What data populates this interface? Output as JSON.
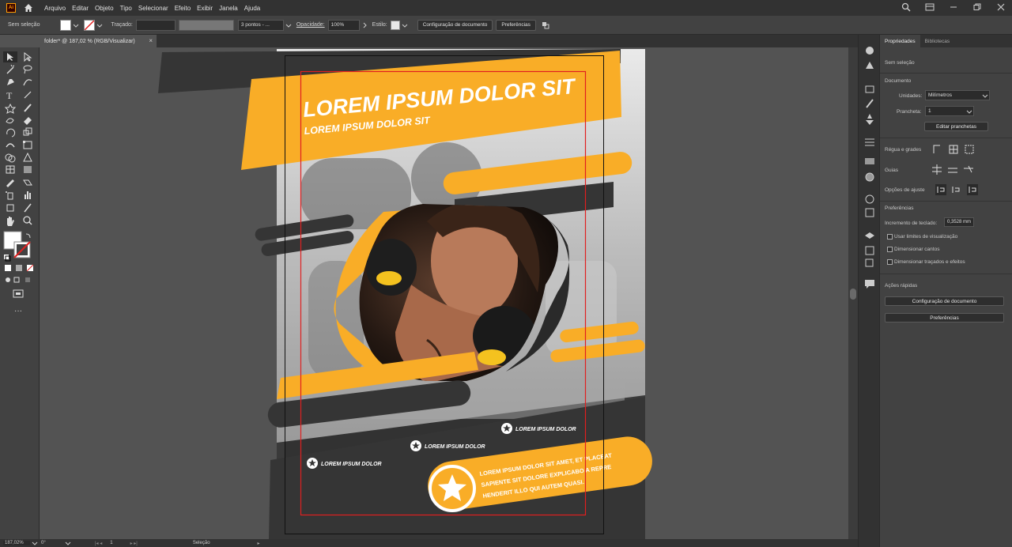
{
  "app": {
    "logo": "Ai"
  },
  "menu": [
    "Arquivo",
    "Editar",
    "Objeto",
    "Tipo",
    "Selecionar",
    "Efeito",
    "Exibir",
    "Janela",
    "Ajuda"
  ],
  "control": {
    "selection": "Sem seleção",
    "stroke_label": "Traçado:",
    "brush": "3 pontos - ...",
    "opacity_label": "Opacidade:",
    "opacity": "100%",
    "style_label": "Estilo:",
    "doc_setup": "Configuração de documento",
    "prefs": "Preferências"
  },
  "document_tab": {
    "title": "folder* @ 187,02 % (RGB/Visualizar)",
    "close": "×"
  },
  "flyer": {
    "headline": "LOREM IPSUM DOLOR SIT",
    "subhead": "LOREM IPSUM DOLOR SIT",
    "label1": "LOREM IPSUM DOLOR",
    "label2": "LOREM IPSUM DOLOR",
    "label3": "LOREM IPSUM DOLOR",
    "body_line1": "LOREM IPSUM DOLOR SIT AMET, ET PLACEAT",
    "body_line2": "SAPIENTE SIT DOLORE EXPLICABO A REPRE",
    "body_line3": "HENDERIT ILLO QUI AUTEM QUASI."
  },
  "status": {
    "zoom": "187,02%",
    "angle": "0°",
    "page": "1",
    "tool": "Seleção"
  },
  "panel": {
    "tabs": [
      "Propriedades",
      "Bibliotecas"
    ],
    "no_selection": "Sem seleção",
    "document": "Documento",
    "units_label": "Unidades:",
    "units_value": "Milímetros",
    "artboard_label": "Prancheta:",
    "artboard_value": "1",
    "edit_artboards": "Editar pranchetas",
    "rulers": "Régua e grades",
    "guides": "Guias",
    "snap": "Opções de ajuste",
    "preferences": "Preferências",
    "keyboard_increment_label": "Incremento de teclado:",
    "keyboard_increment": "0,3528 mm",
    "opt1": "Usar limites de visualização",
    "opt2": "Dimensionar cantos",
    "opt3": "Dimensionar traçados e efeitos",
    "quick_actions": "Ações rápidas",
    "doc_setup": "Configuração de documento",
    "prefs": "Preferências"
  },
  "colors": {
    "accent": "#f9ad27",
    "dark": "#333333",
    "ui_dark": "#323232",
    "ui_mid": "#424242",
    "canvas": "#535353",
    "artboard_border": "#e02020"
  }
}
